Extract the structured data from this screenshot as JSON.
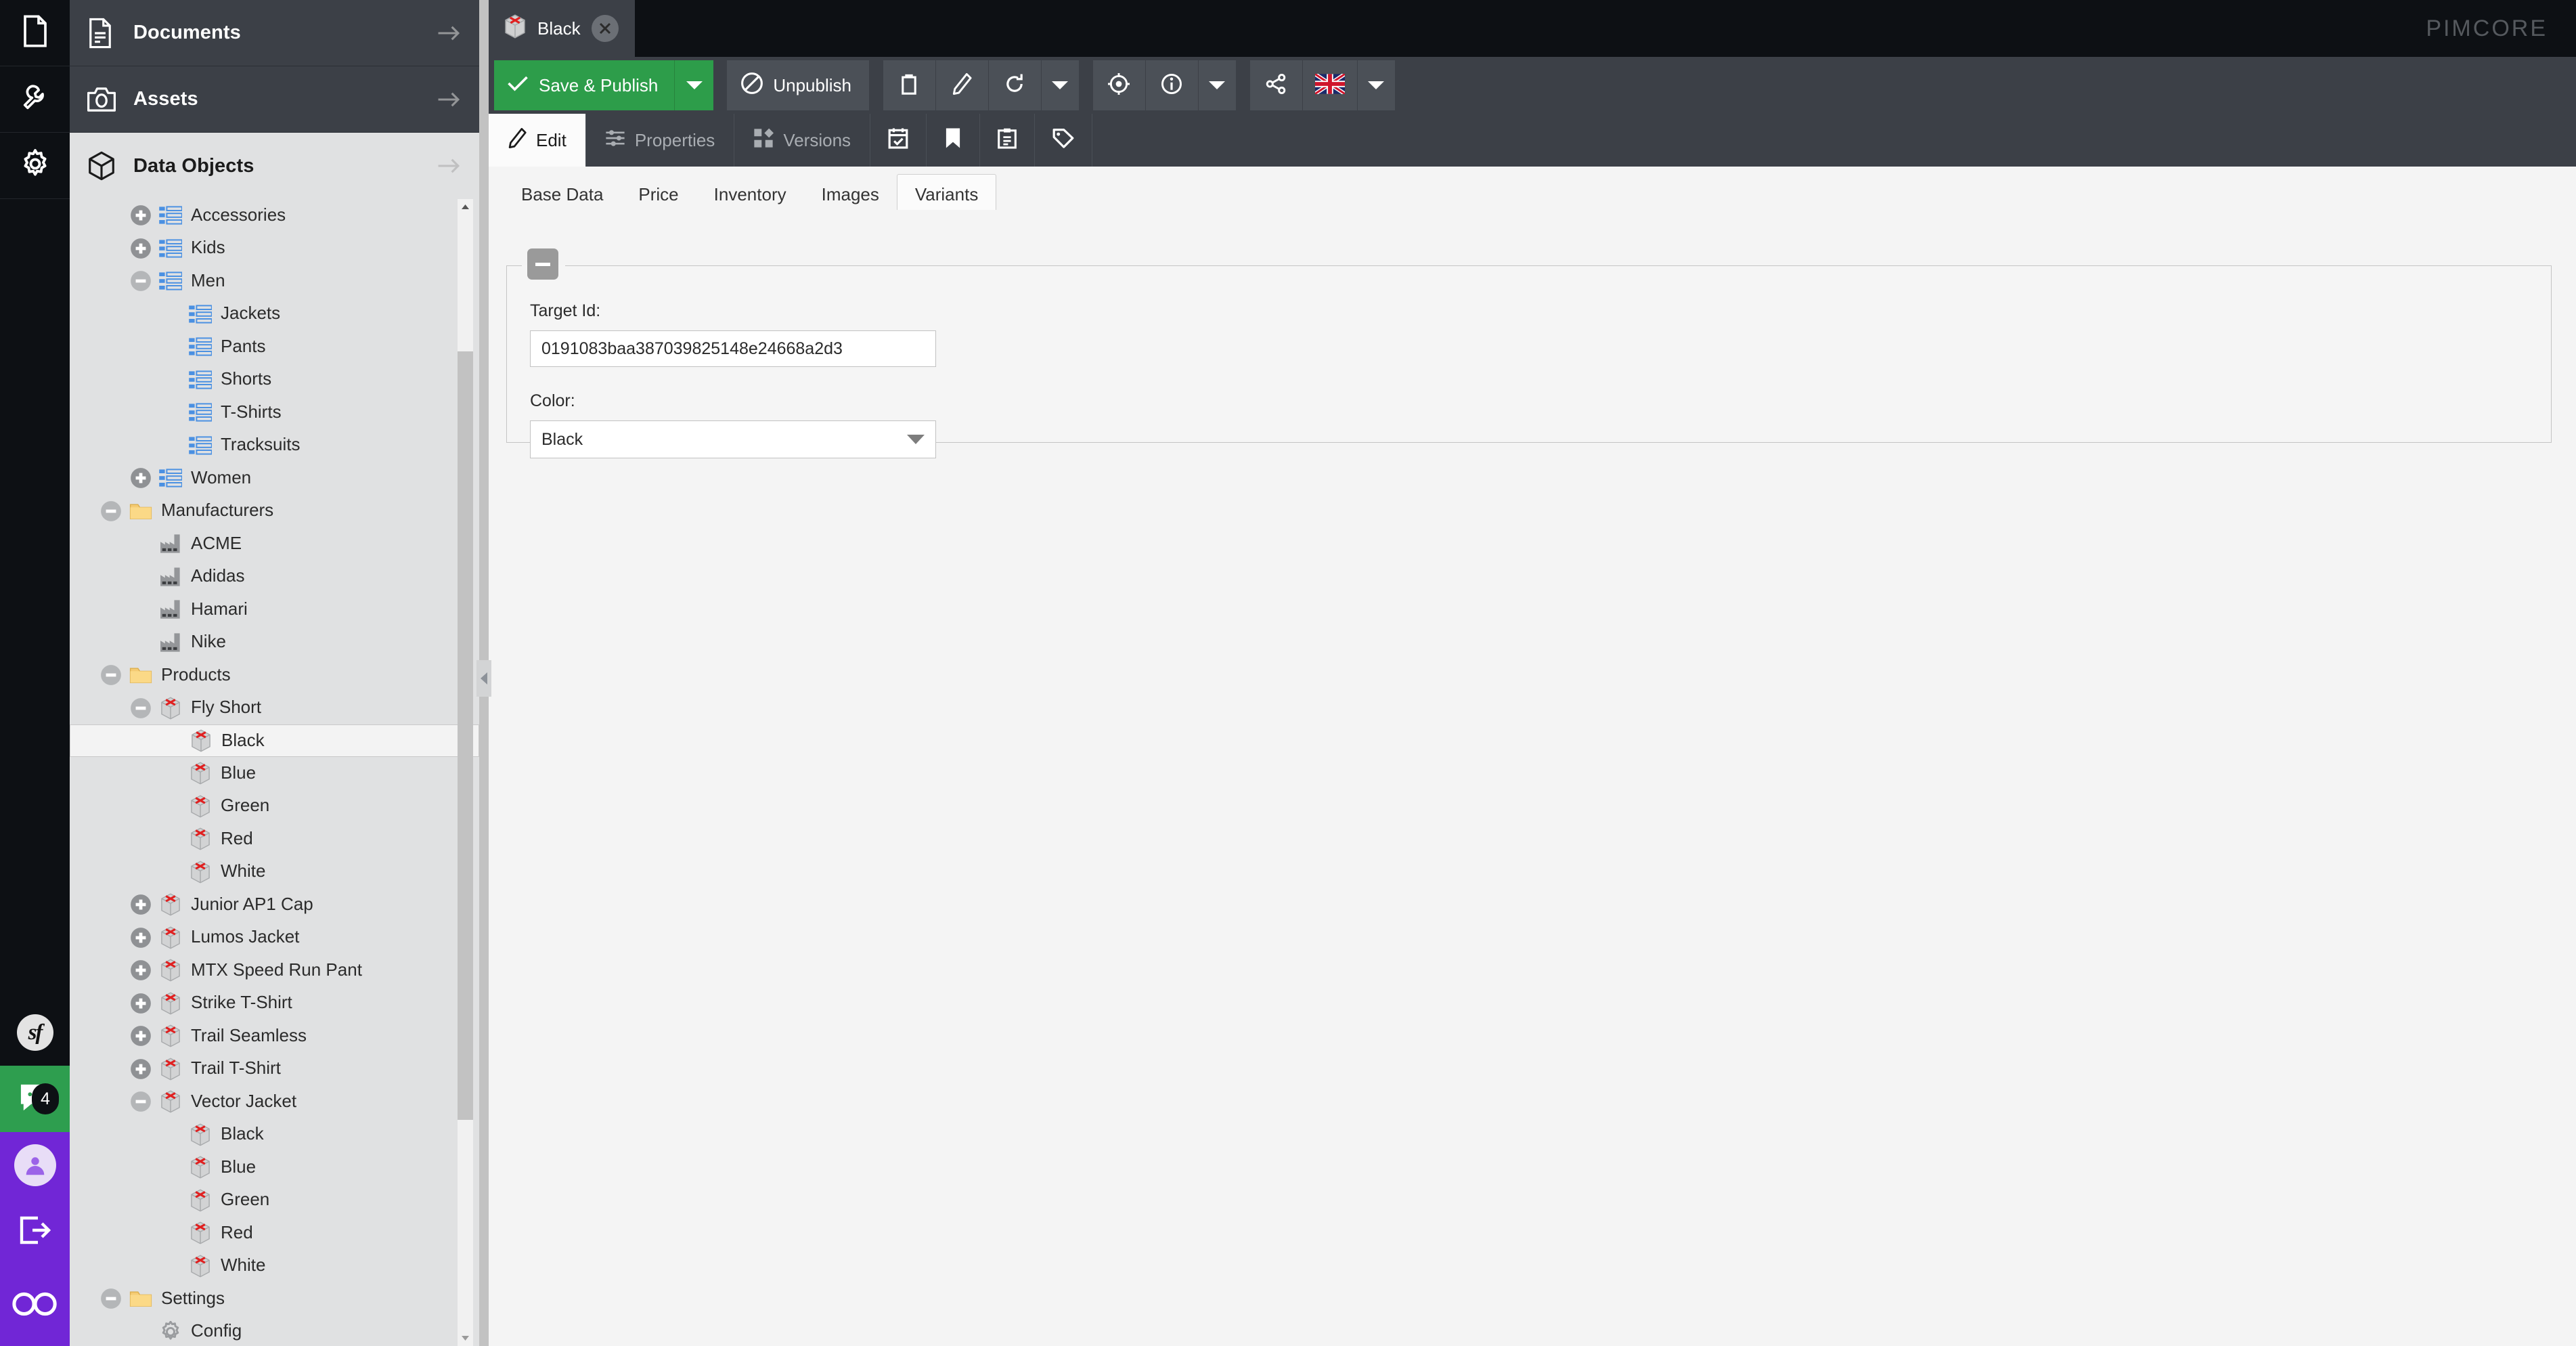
{
  "brand": {
    "name": "PIMCORE"
  },
  "rail": {
    "items": [
      {
        "icon": "document-icon",
        "name": "rail-documents"
      },
      {
        "icon": "wrench-icon",
        "name": "rail-tools"
      },
      {
        "icon": "gear-icon",
        "name": "rail-settings"
      }
    ],
    "symfony_label": "sf",
    "chat_badge_count": "4"
  },
  "nav": {
    "sections": [
      {
        "label": "Documents",
        "icon": "document-icon",
        "active": false
      },
      {
        "label": "Assets",
        "icon": "camera-icon",
        "active": false
      },
      {
        "label": "Data Objects",
        "icon": "cube-icon",
        "active": true
      }
    ]
  },
  "tree": {
    "nodes": [
      {
        "label": "Accessories",
        "indent": 0,
        "toggle": "plus",
        "icon": "object-list-icon",
        "selected": false
      },
      {
        "label": "Kids",
        "indent": 0,
        "toggle": "plus",
        "icon": "object-list-icon",
        "selected": false
      },
      {
        "label": "Men",
        "indent": 0,
        "toggle": "minus",
        "icon": "object-list-icon",
        "selected": false
      },
      {
        "label": "Jackets",
        "indent": 1,
        "toggle": "none",
        "icon": "object-list-icon",
        "selected": false
      },
      {
        "label": "Pants",
        "indent": 1,
        "toggle": "none",
        "icon": "object-list-icon",
        "selected": false
      },
      {
        "label": "Shorts",
        "indent": 1,
        "toggle": "none",
        "icon": "object-list-icon",
        "selected": false
      },
      {
        "label": "T-Shirts",
        "indent": 1,
        "toggle": "none",
        "icon": "object-list-icon",
        "selected": false
      },
      {
        "label": "Tracksuits",
        "indent": 1,
        "toggle": "none",
        "icon": "object-list-icon",
        "selected": false
      },
      {
        "label": "Women",
        "indent": 0,
        "toggle": "plus",
        "icon": "object-list-icon",
        "selected": false
      },
      {
        "label": "Manufacturers",
        "indent": -1,
        "toggle": "minus",
        "icon": "folder-icon",
        "selected": false
      },
      {
        "label": "ACME",
        "indent": 0,
        "toggle": "none",
        "icon": "factory-icon",
        "selected": false
      },
      {
        "label": "Adidas",
        "indent": 0,
        "toggle": "none",
        "icon": "factory-icon",
        "selected": false
      },
      {
        "label": "Hamari",
        "indent": 0,
        "toggle": "none",
        "icon": "factory-icon",
        "selected": false
      },
      {
        "label": "Nike",
        "indent": 0,
        "toggle": "none",
        "icon": "factory-icon",
        "selected": false
      },
      {
        "label": "Products",
        "indent": -1,
        "toggle": "minus",
        "icon": "folder-icon",
        "selected": false
      },
      {
        "label": "Fly Short",
        "indent": 0,
        "toggle": "minus",
        "icon": "product-box-icon",
        "selected": false
      },
      {
        "label": "Black",
        "indent": 1,
        "toggle": "none",
        "icon": "product-box-icon",
        "selected": true
      },
      {
        "label": "Blue",
        "indent": 1,
        "toggle": "none",
        "icon": "product-box-icon",
        "selected": false
      },
      {
        "label": "Green",
        "indent": 1,
        "toggle": "none",
        "icon": "product-box-icon",
        "selected": false
      },
      {
        "label": "Red",
        "indent": 1,
        "toggle": "none",
        "icon": "product-box-icon",
        "selected": false
      },
      {
        "label": "White",
        "indent": 1,
        "toggle": "none",
        "icon": "product-box-icon",
        "selected": false
      },
      {
        "label": "Junior AP1 Cap",
        "indent": 0,
        "toggle": "plus",
        "icon": "product-box-icon",
        "selected": false
      },
      {
        "label": "Lumos Jacket",
        "indent": 0,
        "toggle": "plus",
        "icon": "product-box-icon",
        "selected": false
      },
      {
        "label": "MTX Speed Run Pant",
        "indent": 0,
        "toggle": "plus",
        "icon": "product-box-icon",
        "selected": false
      },
      {
        "label": "Strike T-Shirt",
        "indent": 0,
        "toggle": "plus",
        "icon": "product-box-icon",
        "selected": false
      },
      {
        "label": "Trail Seamless",
        "indent": 0,
        "toggle": "plus",
        "icon": "product-box-icon",
        "selected": false
      },
      {
        "label": "Trail T-Shirt",
        "indent": 0,
        "toggle": "plus",
        "icon": "product-box-icon",
        "selected": false
      },
      {
        "label": "Vector Jacket",
        "indent": 0,
        "toggle": "minus",
        "icon": "product-box-icon",
        "selected": false
      },
      {
        "label": "Black",
        "indent": 1,
        "toggle": "none",
        "icon": "product-box-icon",
        "selected": false
      },
      {
        "label": "Blue",
        "indent": 1,
        "toggle": "none",
        "icon": "product-box-icon",
        "selected": false
      },
      {
        "label": "Green",
        "indent": 1,
        "toggle": "none",
        "icon": "product-box-icon",
        "selected": false
      },
      {
        "label": "Red",
        "indent": 1,
        "toggle": "none",
        "icon": "product-box-icon",
        "selected": false
      },
      {
        "label": "White",
        "indent": 1,
        "toggle": "none",
        "icon": "product-box-icon",
        "selected": false
      },
      {
        "label": "Settings",
        "indent": -1,
        "toggle": "minus",
        "icon": "folder-icon",
        "selected": false
      },
      {
        "label": "Config",
        "indent": 0,
        "toggle": "none",
        "icon": "config-gear-icon",
        "selected": false
      }
    ]
  },
  "document_tab": {
    "label": "Black",
    "icon": "product-box-icon",
    "close": "close-icon"
  },
  "toolbar": {
    "save_publish_label": "Save & Publish",
    "unpublish_label": "Unpublish",
    "accent_green": "#2d9d4a",
    "icon_buttons": [
      {
        "name": "delete-button",
        "icon": "trash-icon"
      },
      {
        "name": "rename-button",
        "icon": "pencil-icon"
      },
      {
        "name": "reload-button",
        "icon": "reload-icon"
      },
      {
        "name": "reload-menu-button",
        "icon": "chevron-down-icon"
      },
      {
        "name": "locate-button",
        "icon": "target-icon"
      },
      {
        "name": "info-button",
        "icon": "info-icon"
      },
      {
        "name": "info-menu-button",
        "icon": "chevron-down-icon"
      },
      {
        "name": "share-button",
        "icon": "share-icon"
      },
      {
        "name": "language-button",
        "icon": "uk-flag-icon"
      },
      {
        "name": "language-menu-button",
        "icon": "chevron-down-icon"
      }
    ]
  },
  "subtabs": {
    "items": [
      {
        "label": "Edit",
        "icon": "pencil-icon",
        "active": true
      },
      {
        "label": "Properties",
        "icon": "sliders-icon",
        "active": false
      },
      {
        "label": "Versions",
        "icon": "versions-icon",
        "active": false
      }
    ],
    "icon_only": [
      {
        "name": "schedule-tab",
        "icon": "calendar-check-icon"
      },
      {
        "name": "bookmark-tab",
        "icon": "bookmark-icon"
      },
      {
        "name": "notes-tab",
        "icon": "clipboard-list-icon"
      },
      {
        "name": "tags-tab",
        "icon": "tag-icon"
      }
    ]
  },
  "content_tabs": {
    "items": [
      {
        "label": "Base Data",
        "active": false
      },
      {
        "label": "Price",
        "active": false
      },
      {
        "label": "Inventory",
        "active": false
      },
      {
        "label": "Images",
        "active": false
      },
      {
        "label": "Variants",
        "active": true
      }
    ]
  },
  "form": {
    "target_id_label": "Target Id:",
    "target_id_value": "0191083baa387039825148e24668a2d3",
    "color_label": "Color:",
    "color_value": "Black"
  }
}
